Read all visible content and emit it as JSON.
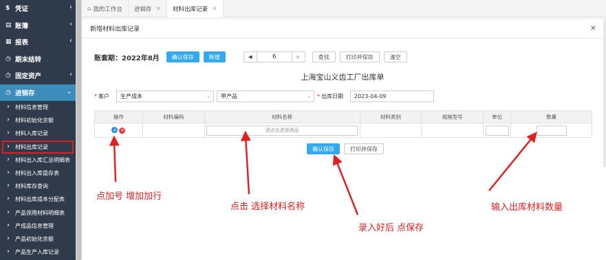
{
  "sidebar": {
    "menus_top": [
      {
        "icon": "$",
        "label": "凭证"
      },
      {
        "icon": "▤",
        "label": "账簿"
      },
      {
        "icon": "▦",
        "label": "报表"
      },
      {
        "icon": "◷",
        "label": "期末结转"
      },
      {
        "icon": "◷",
        "label": "固定资产"
      }
    ],
    "active_menu": {
      "icon": "◷",
      "label": "进销存"
    },
    "sub_items": [
      "材料信息管理",
      "材料初始化余额",
      "材料入库记录",
      "材料出库记录",
      "材料出入库汇总明细表",
      "材料出入库盘存表",
      "材料库存查询",
      "材料出库成本分配表",
      "产品领用材料明细表",
      "产成品信息管理",
      "产品初始化余额",
      "产品生产入库记录"
    ],
    "current_sub": "材料出库记录"
  },
  "tabs": [
    {
      "label": "我的工作台",
      "closable": false
    },
    {
      "label": "进销存",
      "closable": true
    },
    {
      "label": "材料出库记录",
      "closable": true
    }
  ],
  "dialog": {
    "title": "新增材料出库记录",
    "close": "×",
    "period": "账套期：2022年8月",
    "buttons": {
      "confirm_save": "确认保存",
      "add_new": "新增",
      "search": "查找",
      "print_save": "打印并保存",
      "clear": "清空"
    },
    "pager": {
      "prev": "◀",
      "page": "6",
      "next": "▶"
    },
    "doc_title": "上海宝山义齿工厂出库单",
    "customer_label": "客户",
    "customer_value": "生产成本",
    "product_value": "甲产品",
    "date_label": "出库日期",
    "date_value": "2023-04-09",
    "table_headers": [
      "操作",
      "材料编码",
      "材料名称",
      "材料类别",
      "规格型号",
      "单位",
      "数量"
    ],
    "name_placeholder": "请点击选择商品",
    "bottom_confirm": "确认保存",
    "bottom_print": "打印并保存"
  },
  "annotations": {
    "add_row": "点加号  增加加行",
    "select_material": "点击 选择材料名称",
    "save_after": "录入好后 点保存",
    "enter_qty": "输入出库材料数量"
  },
  "colors": {
    "sidebar_bg": "#2f3a4a",
    "active_menu": "#3c8dbc",
    "primary_btn": "#33aaf0",
    "annotation": "#e02020"
  }
}
